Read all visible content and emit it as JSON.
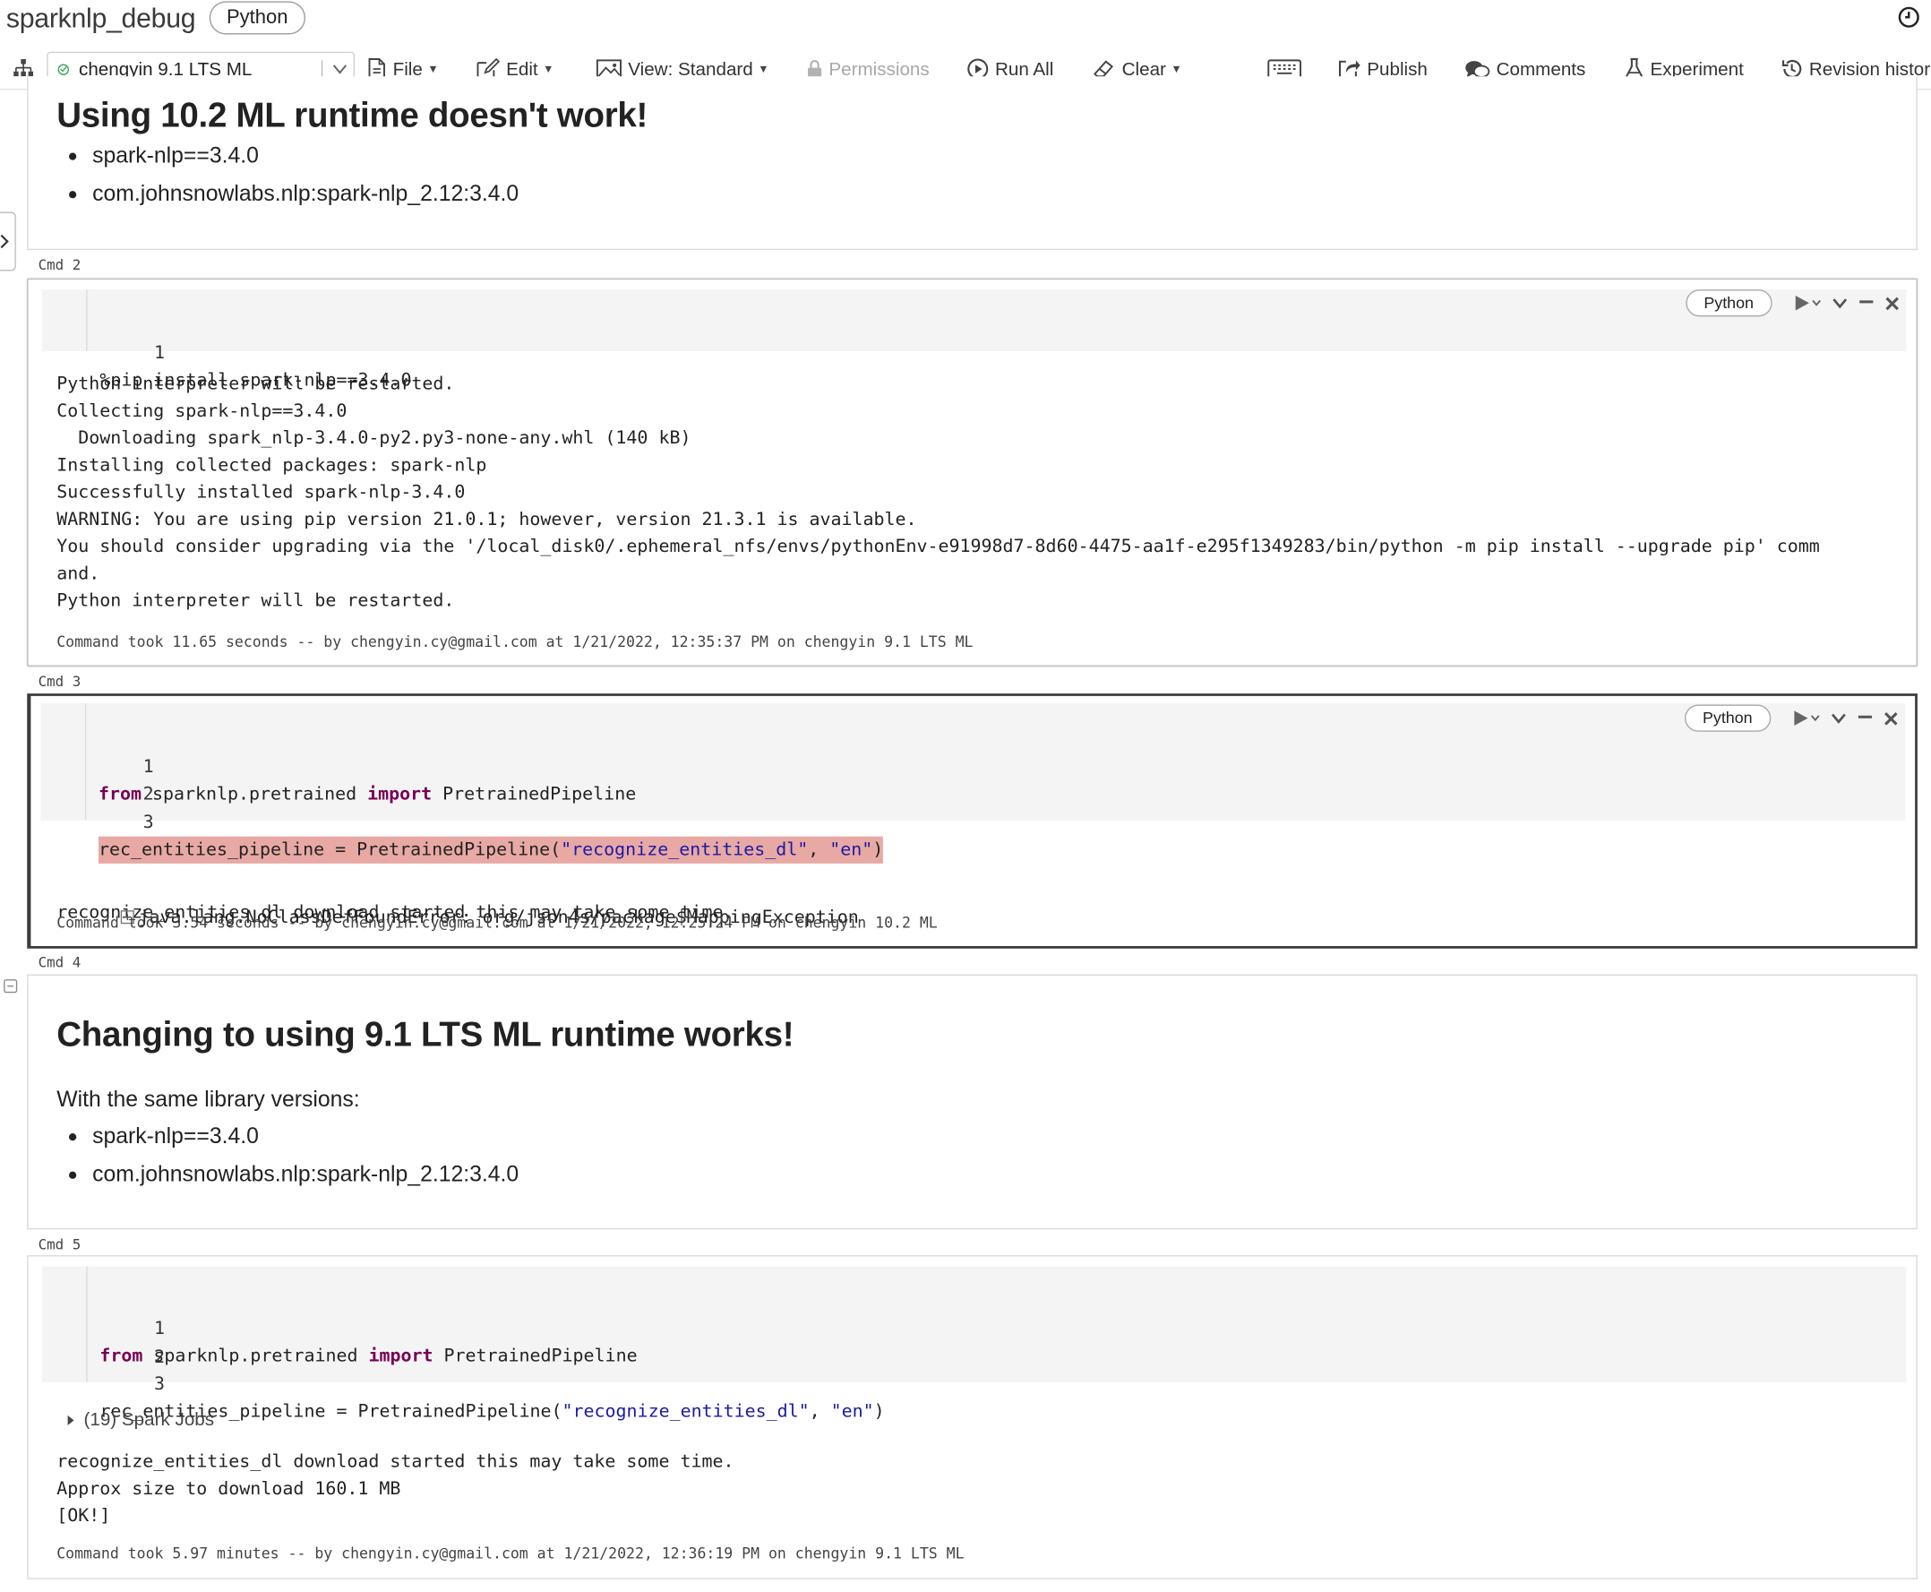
{
  "notebook": {
    "title": "sparknlp_debug",
    "language": "Python"
  },
  "toolbar": {
    "cluster_name": "chengyin 9.1 LTS ML",
    "file": "File",
    "edit": "Edit",
    "view": "View: Standard",
    "permissions": "Permissions",
    "run_all": "Run All",
    "clear": "Clear",
    "publish": "Publish",
    "comments": "Comments",
    "experiment": "Experiment",
    "revision_history": "Revision histor"
  },
  "cells": {
    "md1": {
      "heading": "Using 10.2 ML runtime doesn't work!",
      "items": [
        "spark-nlp==3.4.0",
        "com.johnsnowlabs.nlp:spark-nlp_2.12:3.4.0"
      ]
    },
    "cmd2": {
      "label": "Cmd 2",
      "language": "Python",
      "line_numbers": [
        "1"
      ],
      "code": [
        "%pip install spark-nlp==3.4.0"
      ],
      "output": [
        "Python interpreter will be restarted.",
        "Collecting spark-nlp==3.4.0",
        "  Downloading spark_nlp-3.4.0-py2.py3-none-any.whl (140 kB)",
        "Installing collected packages: spark-nlp",
        "Successfully installed spark-nlp-3.4.0",
        "WARNING: You are using pip version 21.0.1; however, version 21.3.1 is available.",
        "You should consider upgrading via the '/local_disk0/.ephemeral_nfs/envs/pythonEnv-e91998d7-8d60-4475-aa1f-e295f1349283/bin/python -m pip install --upgrade pip' comm",
        "and.",
        "Python interpreter will be restarted."
      ],
      "meta": "Command took 11.65 seconds -- by chengyin.cy@gmail.com at 1/21/2022, 12:35:37 PM on chengyin 9.1 LTS ML"
    },
    "cmd3": {
      "label": "Cmd 3",
      "language": "Python",
      "line_numbers": [
        "1",
        "2",
        "3"
      ],
      "code": {
        "l1_kw1": "from",
        "l1_mid": " sparknlp.pretrained ",
        "l1_kw2": "import",
        "l1_end": " PretrainedPipeline",
        "l3_a": "rec_entities_pipeline = PretrainedPipeline(",
        "l3_s1": "\"recognize_entities_dl\"",
        "l3_b": ", ",
        "l3_s2": "\"en\"",
        "l3_c": ")"
      },
      "output_line": "recognize_entities_dl download started this may take some time.",
      "error": "java.lang.NoClassDefFoundError: org/json4s/package$MappingException",
      "meta": "Command took 3.54 seconds -- by chengyin.cy@gmail.com at 1/21/2022, 12:25:24 PM on chengyin 10.2 ML"
    },
    "md4": {
      "label": "Cmd 4",
      "heading": "Changing to using 9.1 LTS ML runtime works!",
      "paragraph": "With the same library versions:",
      "items": [
        "spark-nlp==3.4.0",
        "com.johnsnowlabs.nlp:spark-nlp_2.12:3.4.0"
      ]
    },
    "cmd5": {
      "label": "Cmd 5",
      "line_numbers": [
        "1",
        "2",
        "3"
      ],
      "code": {
        "l1_kw1": "from",
        "l1_mid": " sparknlp.pretrained ",
        "l1_kw2": "import",
        "l1_end": " PretrainedPipeline",
        "l3_a": "rec_entities_pipeline = PretrainedPipeline(",
        "l3_s1": "\"recognize_entities_dl\"",
        "l3_b": ", ",
        "l3_s2": "\"en\"",
        "l3_c": ")"
      },
      "spark_jobs": "(19) Spark Jobs",
      "output": [
        "recognize_entities_dl download started this may take some time.",
        "Approx size to download 160.1 MB",
        "[OK!]"
      ],
      "meta": "Command took 5.97 minutes -- by chengyin.cy@gmail.com at 1/21/2022, 12:36:19 PM on chengyin 9.1 LTS ML"
    }
  },
  "colors": {
    "keyword": "#770055",
    "string": "#1a1aa6",
    "error_highlight": "#e8a9a4",
    "cluster_ok": "#35a854"
  }
}
